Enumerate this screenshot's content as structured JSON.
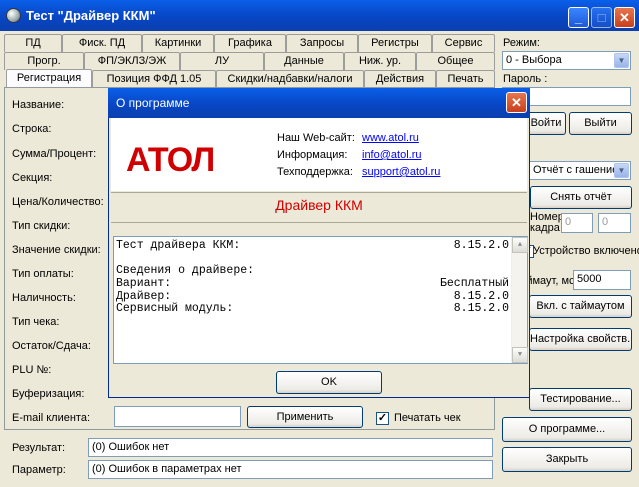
{
  "window": {
    "title": "Тест \"Драйвер ККМ\""
  },
  "tabs_row1": [
    "ПД",
    "Фиск. ПД",
    "Картинки",
    "Графика",
    "Запросы",
    "Регистры",
    "Сервис"
  ],
  "tabs_row2": [
    "Прогр.",
    "ФП/ЭКЛЗ/ЭЖ",
    "ЛУ",
    "Данные",
    "Ниж. ур.",
    "Общее"
  ],
  "tabs_row3": [
    "Регистрация",
    "Позиция ФФД 1.05",
    "Скидки/надбавки/налоги",
    "Действия",
    "Печать"
  ],
  "fields": {
    "labels": [
      "Название:",
      "Строка:",
      "Сумма/Процент:",
      "Секция:",
      "Цена/Количество:",
      "Тип скидки:",
      "Значение скидки:",
      "Тип оплаты:",
      "Наличность:",
      "Тип чека:",
      "Остаток/Сдача:",
      "PLU №:",
      "Буферизация:",
      "E-mail клиента:"
    ],
    "apply_button": "Применить",
    "print_check_label": "Печатать чек",
    "print_check_checked": "✓"
  },
  "right_panel": {
    "mode_label": "Режим:",
    "mode_value": "0 - Выбора",
    "password_label": "Пароль :",
    "enter_button": "Войти",
    "exit_button": "Выйти",
    "report_type_value": "Отчёт с гашением",
    "remove_report_button": "Снять отчёт",
    "numbers_label": "Номера",
    "frame_label": "кадра",
    "frame_from": "0",
    "frame_to": "0",
    "device_enabled_label": "Устройство включено",
    "device_enabled_checked": "✓",
    "timeout_label": "Таймаут, мс:",
    "timeout_value": "5000",
    "timeout_button": "Вкл. с таймаутом",
    "properties_button": "Настройка свойств...",
    "testing_button": "Тестирование...",
    "about_button": "О программе...",
    "close_button": "Закрыть"
  },
  "status": {
    "result_label": "Результат:",
    "result_value": "(0) Ошибок нет",
    "param_label": "Параметр:",
    "param_value": "(0) Ошибок в параметрах нет"
  },
  "dialog": {
    "title": "О программе",
    "logo_text": "АТОЛ",
    "website_label": "Наш Web-сайт:",
    "website_value": "www.atol.ru",
    "info_label": "Информация:",
    "info_value": "info@atol.ru",
    "support_label": "Техподдержка:",
    "support_value": "support@atol.ru",
    "product_name": "Драйвер ККМ",
    "memo_lines": [
      {
        "text": "Тест драйвера ККМ:",
        "value": "8.15.2.0"
      },
      {
        "text": "",
        "value": ""
      },
      {
        "text": "Сведения о драйвере:",
        "value": ""
      },
      {
        "text": "Вариант:",
        "value": "Бесплатный"
      },
      {
        "text": "Драйвер:",
        "value": "8.15.2.0"
      },
      {
        "text": "Сервисный модуль:",
        "value": "8.15.2.0"
      }
    ],
    "ok_button": "OK"
  },
  "colors": {
    "titlebar": "#0846c5",
    "logo_red": "#d00000",
    "link": "#0000ff"
  }
}
